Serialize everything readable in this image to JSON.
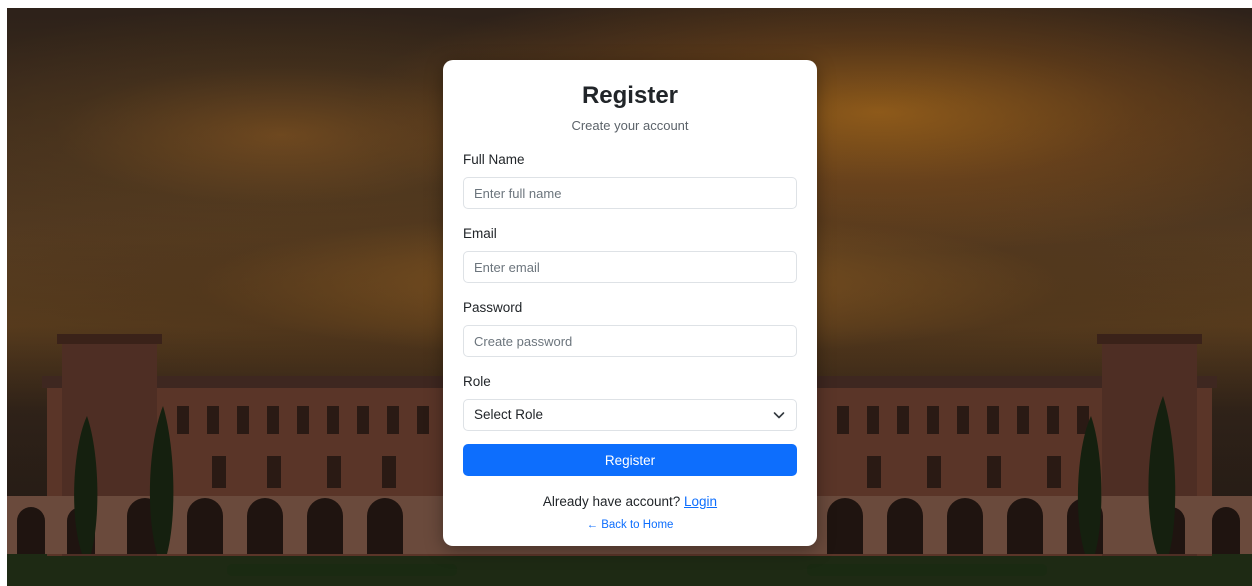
{
  "register_card": {
    "title": "Register",
    "subtitle": "Create your account",
    "full_name": {
      "label": "Full Name",
      "placeholder": "Enter full name",
      "value": ""
    },
    "email": {
      "label": "Email",
      "placeholder": "Enter email",
      "value": ""
    },
    "password": {
      "label": "Password",
      "placeholder": "Create password",
      "value": ""
    },
    "role": {
      "label": "Role",
      "selected": "Select Role"
    },
    "submit_label": "Register",
    "login_prompt": "Already have account?",
    "login_link": "Login",
    "back_link": "← Back to Home"
  },
  "colors": {
    "primary": "#0d6efd",
    "card_background": "#ffffff",
    "text": "#212529",
    "muted_text": "#5c636a"
  },
  "icons": {
    "role_dropdown": "chevron-down-icon"
  }
}
